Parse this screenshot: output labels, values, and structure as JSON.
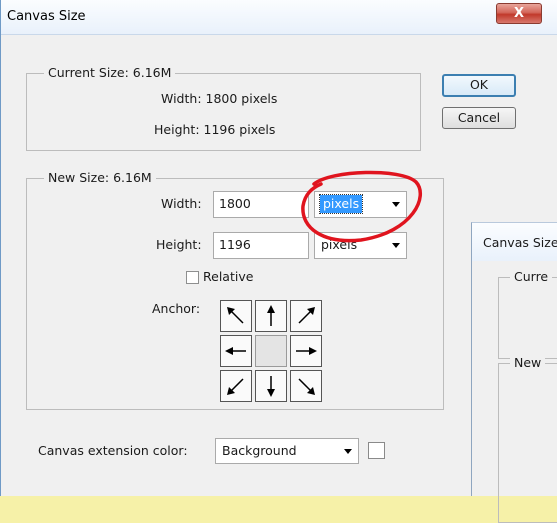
{
  "dialog": {
    "title": "Canvas Size",
    "close_label": "X",
    "current_size": {
      "legend": "Current Size: 6.16M",
      "width_text": "Width:  1800 pixels",
      "height_text": "Height:  1196 pixels"
    },
    "new_size": {
      "legend": "New Size: 6.16M",
      "width_label": "Width:",
      "width_value": "1800",
      "width_unit": "pixels",
      "height_label": "Height:",
      "height_value": "1196",
      "height_unit": "pixels",
      "relative_label": "Relative",
      "relative_checked": false,
      "anchor_label": "Anchor:"
    },
    "buttons": {
      "ok": "OK",
      "cancel": "Cancel"
    },
    "extension": {
      "label": "Canvas extension color:",
      "value": "Background",
      "swatch_color": "#ffffff"
    }
  },
  "second_dialog": {
    "title": "Canvas Size",
    "current_legend": "Curre",
    "new_legend": "New"
  },
  "colors": {
    "highlight": "#3399ff",
    "annotation_circle": "#e0141e",
    "close_button": "#c1392b"
  }
}
